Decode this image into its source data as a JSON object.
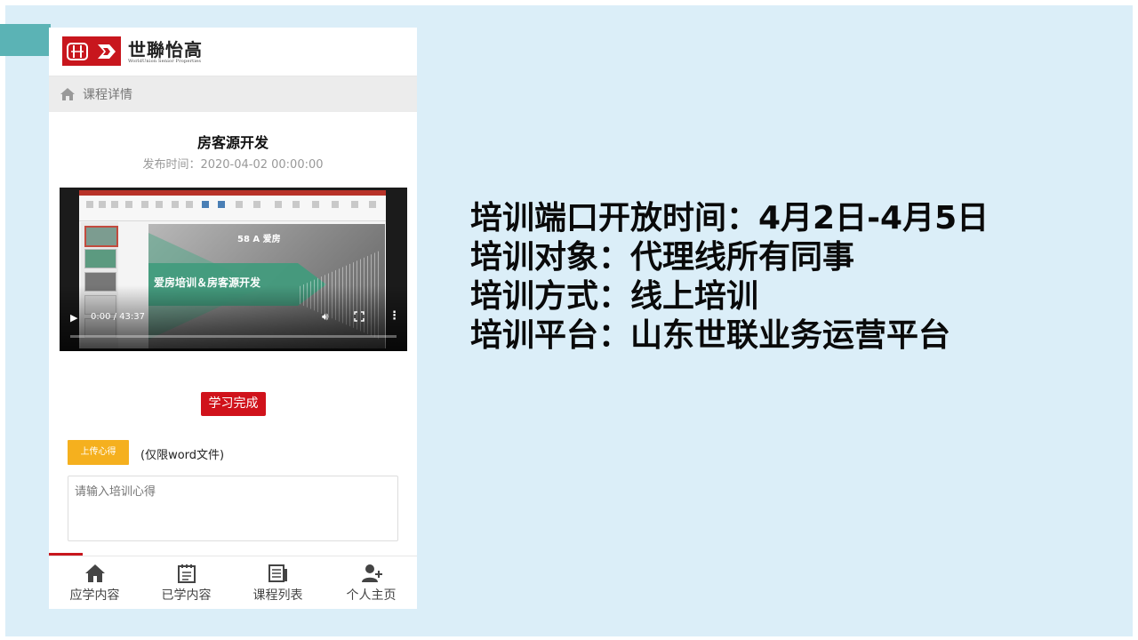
{
  "app": {
    "brand_name": "世聯怡高",
    "brand_sub": "WorldUnion Senior Properties"
  },
  "breadcrumb": {
    "label": "课程详情",
    "icon": "home-icon"
  },
  "course": {
    "title": "房客源开发",
    "publish_date": "发布时间：2020-04-02 00:00:00"
  },
  "video": {
    "slide_title": "爱房培训＆房客源开发",
    "slide_logo": "58 A 爱房",
    "time": "0:00 / 43:37",
    "progress": 0
  },
  "actions": {
    "complete_label": "学习完成",
    "upload_label": "上传心得",
    "upload_note": "(仅限word文件)",
    "notes_placeholder": "请输入培训心得"
  },
  "tabbar": {
    "items": [
      {
        "label": "应学内容",
        "icon": "home-icon"
      },
      {
        "label": "已学内容",
        "icon": "notebook-icon"
      },
      {
        "label": "课程列表",
        "icon": "newspaper-icon"
      },
      {
        "label": "个人主页",
        "icon": "add-user-icon"
      }
    ]
  },
  "slide_text": {
    "lines": [
      "培训端口开放时间：4月2日-4月5日",
      "培训对象：代理线所有同事",
      "培训方式：线上培训",
      "培训平台：山东世联业务运营平台"
    ]
  },
  "colors": {
    "brand_red": "#c8161d",
    "accent_teal": "#5bb3b5",
    "slide_bg": "#dbeef8",
    "upload_yellow": "#f5b01e"
  }
}
